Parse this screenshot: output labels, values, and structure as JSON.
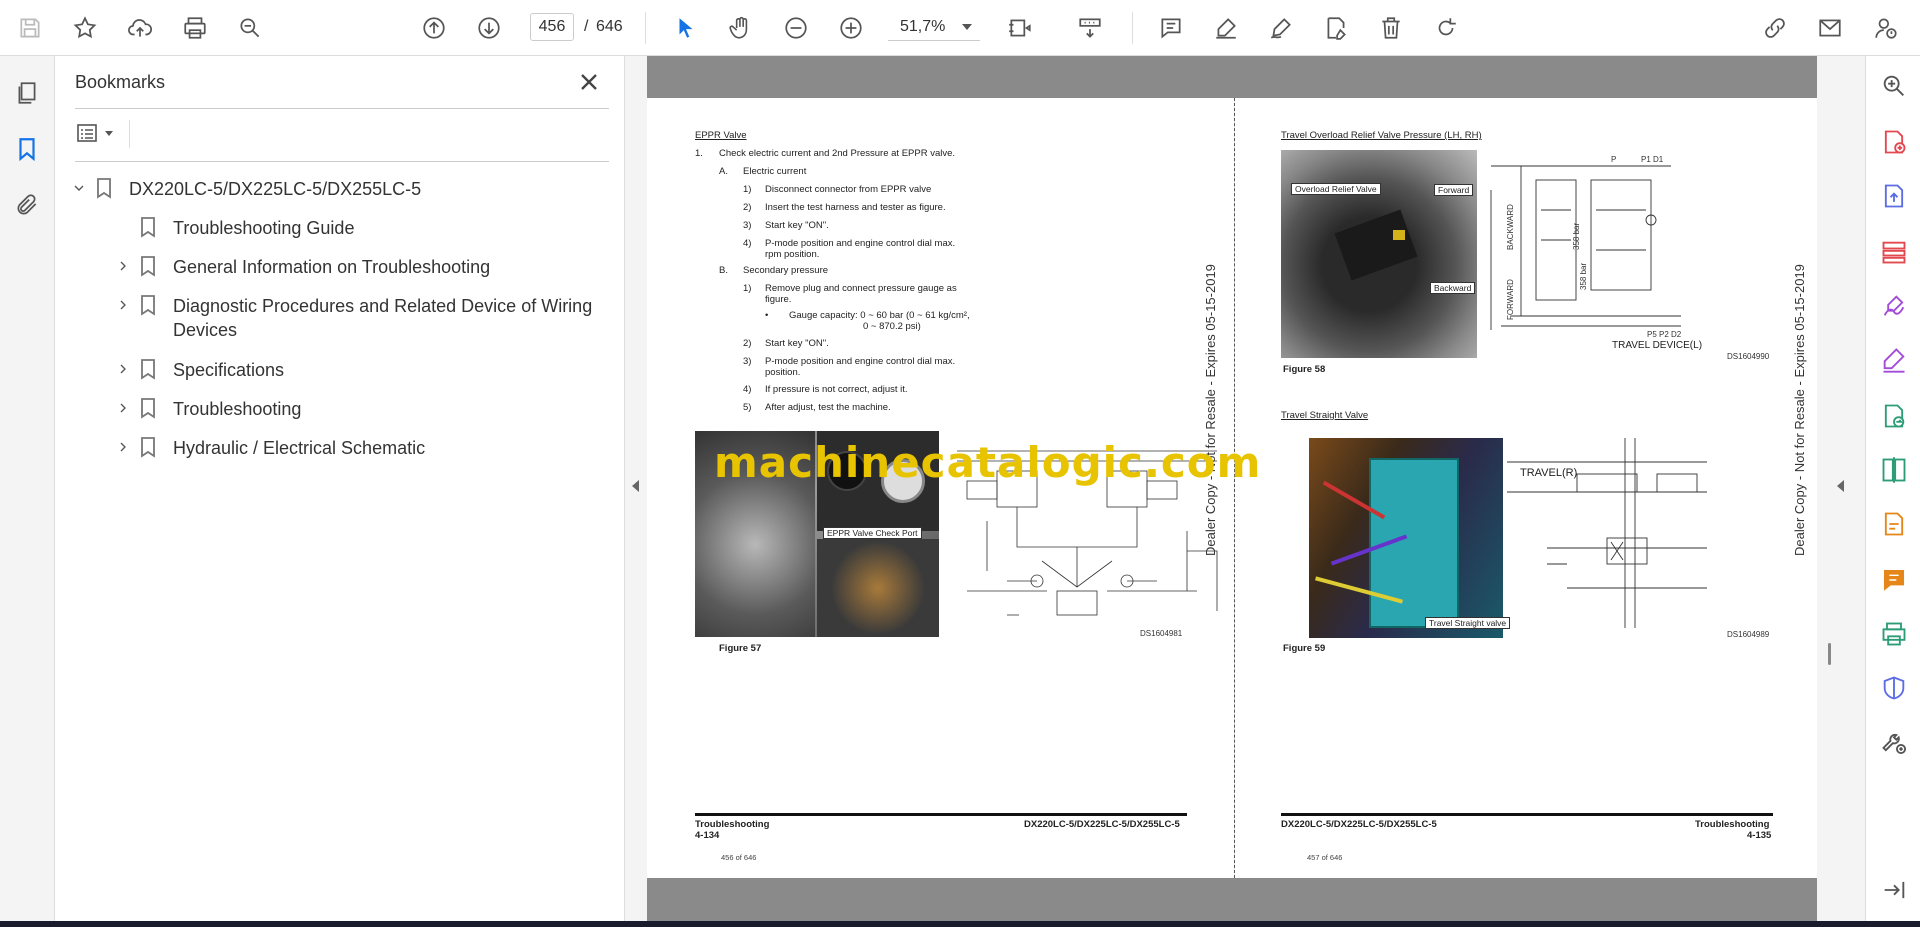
{
  "toolbar": {
    "page_current": "456",
    "page_separator": "/",
    "page_total": "646",
    "zoom": "51,7%"
  },
  "bookmarks_panel": {
    "title": "Bookmarks",
    "items": [
      {
        "label": "DX220LC-5/DX225LC-5/DX255LC-5",
        "expanded": true,
        "level": 0
      },
      {
        "label": "Troubleshooting Guide",
        "level": 1
      },
      {
        "label": "General Information on Troubleshooting",
        "level": 1
      },
      {
        "label": "Diagnostic Procedures and Related Device of Wiring",
        "label2": "Devices",
        "level": 1
      },
      {
        "label": "Specifications",
        "level": 1
      },
      {
        "label": "Troubleshooting",
        "level": 1
      },
      {
        "label": "Hydraulic / Electrical Schematic",
        "level": 1
      }
    ]
  },
  "left_page": {
    "heading": "EPPR Valve",
    "step1": "Check electric current and 2nd Pressure at EPPR valve.",
    "a_label": "Electric current",
    "a_steps": [
      "Disconnect connector from EPPR valve",
      "Insert the test harness and tester as figure.",
      "Start key \"ON\".",
      "P-mode position and engine control dial max.",
      "rpm position."
    ],
    "b_label": "Secondary pressure",
    "b_steps": [
      "Remove plug and connect pressure gauge as",
      "figure.",
      "Gauge capacity: 0 ~ 60 bar (0 ~ 61 kg/cm², ",
      "0 ~ 870.2 psi)",
      "Start key \"ON\".",
      "P-mode position and engine control dial max.",
      "position.",
      "If pressure is not correct, adjust it.",
      "After adjust, test the machine."
    ],
    "figure": "Figure 57",
    "callout": "EPPR Valve Check Port",
    "ds": "DS1604981",
    "footer_left": "Troubleshooting",
    "footer_page": "4-134",
    "footer_right": "DX220LC-5/DX225LC-5/DX255LC-5",
    "page_of": "456 of 646"
  },
  "right_page": {
    "heading1": "Travel Overload Relief Valve Pressure (LH, RH)",
    "callouts1": [
      "Overload Relief Valve",
      "Forward",
      "Backward"
    ],
    "device_label": "TRAVEL DEVICE(L)",
    "figure1": "Figure 58",
    "ds1": "DS1604990",
    "heading2": "Travel Straight Valve",
    "callout2": "Travel Straight valve",
    "travel_label": "TRAVEL(R)",
    "figure2": "Figure 59",
    "ds2": "DS1604989",
    "footer_left": "DX220LC-5/DX225LC-5/DX255LC-5",
    "footer_right": "Troubleshooting",
    "footer_page": "4-135",
    "page_of": "457 of 646"
  },
  "side_stamp": "Dealer Copy - Not for Resale - Expires 05-15-2019",
  "watermark": "machinecatalogic.com",
  "colors": {
    "accent_blue": "#1473e6",
    "gray_bar": "#8a8a8a",
    "watermark": "#e8c400"
  }
}
